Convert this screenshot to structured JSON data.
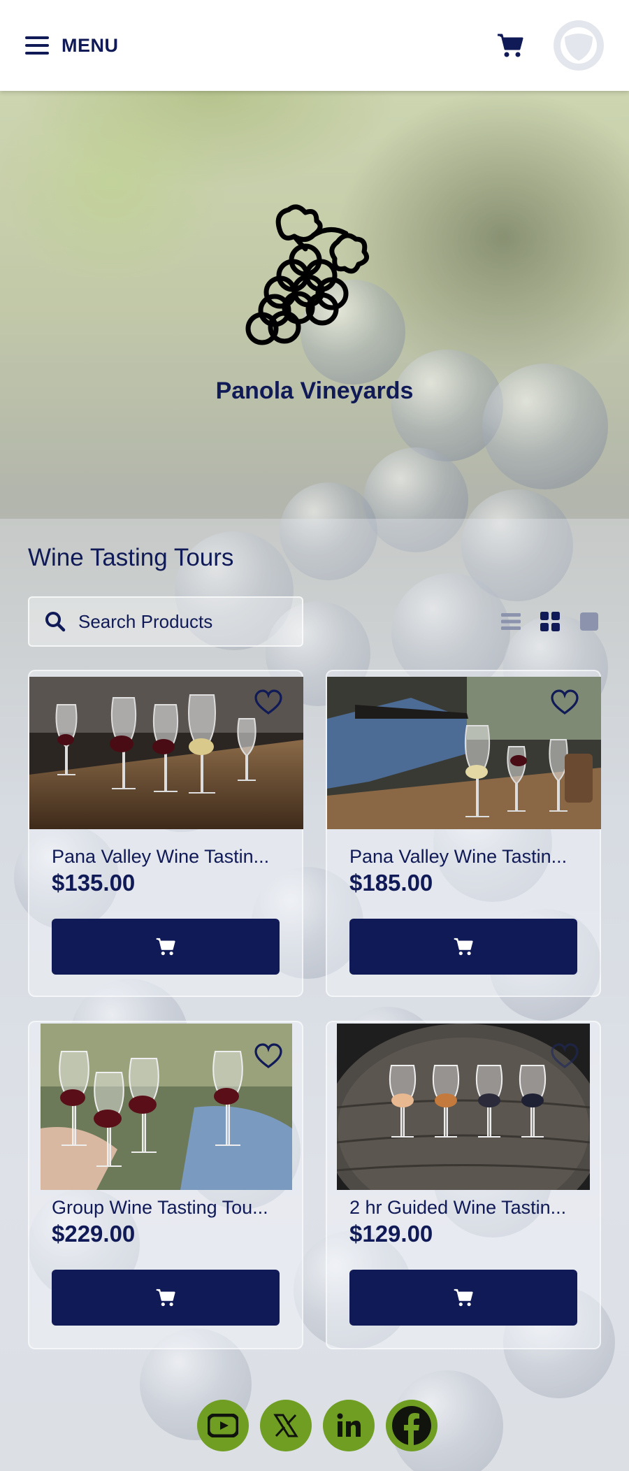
{
  "header": {
    "menu_label": "MENU",
    "icons": {
      "menu": "hamburger-icon",
      "cart": "cart-icon",
      "avatar": "user-avatar"
    }
  },
  "hero": {
    "title": "Panola Vineyards",
    "logo_icon": "grapes-icon"
  },
  "section": {
    "title": "Wine Tasting Tours"
  },
  "search": {
    "placeholder": "Search Products"
  },
  "view_options": [
    "list-view-icon",
    "grid-view-icon",
    "single-view-icon"
  ],
  "products": [
    {
      "name": "Pana Valley Wine Tastin...",
      "price": "$135.00"
    },
    {
      "name": "Pana Valley Wine Tastin...",
      "price": "$185.00"
    },
    {
      "name": "Group Wine Tasting Tou...",
      "price": "$229.00"
    },
    {
      "name": "2 hr Guided Wine Tastin...",
      "price": "$129.00"
    }
  ],
  "social": [
    "youtube-icon",
    "x-icon",
    "linkedin-icon",
    "facebook-icon"
  ],
  "colors": {
    "primary": "#101a56",
    "social": "#6f9e23",
    "header_bg": "#ffffff"
  }
}
